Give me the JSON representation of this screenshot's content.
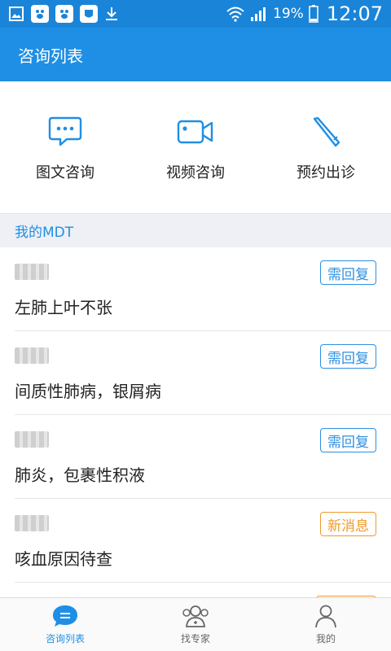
{
  "status_bar": {
    "battery": "19%",
    "time": "12:07"
  },
  "header": {
    "title": "咨询列表"
  },
  "quick_actions": [
    {
      "label": "图文咨询",
      "icon": "chat-bubble-icon"
    },
    {
      "label": "视频咨询",
      "icon": "video-camera-icon"
    },
    {
      "label": "预约出诊",
      "icon": "pen-icon"
    }
  ],
  "section": {
    "title": "我的MDT"
  },
  "consultations": [
    {
      "title": "左肺上叶不张",
      "badge": "需回复",
      "badge_color": "#2e8fe0"
    },
    {
      "title": "间质性肺病，银屑病",
      "badge": "需回复",
      "badge_color": "#2e8fe0"
    },
    {
      "title": "肺炎，包裹性积液",
      "badge": "需回复",
      "badge_color": "#2e8fe0"
    },
    {
      "title": "咳血原因待查",
      "badge": "新消息",
      "badge_color": "#ef9a2a"
    }
  ],
  "tabs": [
    {
      "label": "咨询列表",
      "icon": "chat-tab-icon",
      "active": true
    },
    {
      "label": "找专家",
      "icon": "experts-icon",
      "active": false
    },
    {
      "label": "我的",
      "icon": "profile-icon",
      "active": false
    }
  ],
  "colors": {
    "primary": "#1f8fe5",
    "status_bar": "#1a84d8",
    "badge_blue": "#2e8fe0",
    "badge_orange": "#ef9a2a"
  }
}
